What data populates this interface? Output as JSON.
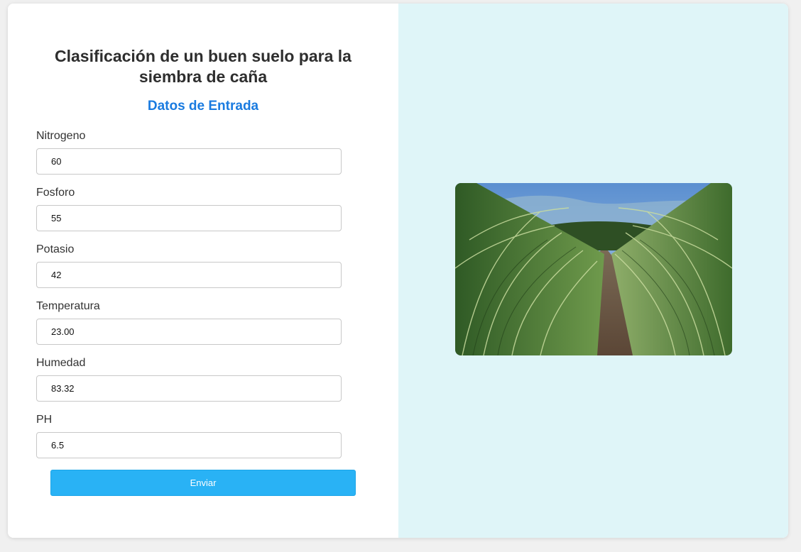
{
  "page": {
    "title": "Clasificación de un buen suelo para la siembra de caña",
    "subtitle": "Datos de Entrada"
  },
  "form": {
    "fields": [
      {
        "label": "Nitrogeno",
        "value": "60"
      },
      {
        "label": "Fosforo",
        "value": "55"
      },
      {
        "label": "Potasio",
        "value": "42"
      },
      {
        "label": "Temperatura",
        "value": "23.00"
      },
      {
        "label": "Humedad",
        "value": "83.32"
      },
      {
        "label": "PH",
        "value": "6.5"
      }
    ],
    "submit_label": "Enviar"
  },
  "colors": {
    "accent": "#1a7be0",
    "button": "#29b2f5",
    "right_panel": "#dff5f8"
  },
  "image": {
    "subject": "sugarcane-field-photo"
  }
}
